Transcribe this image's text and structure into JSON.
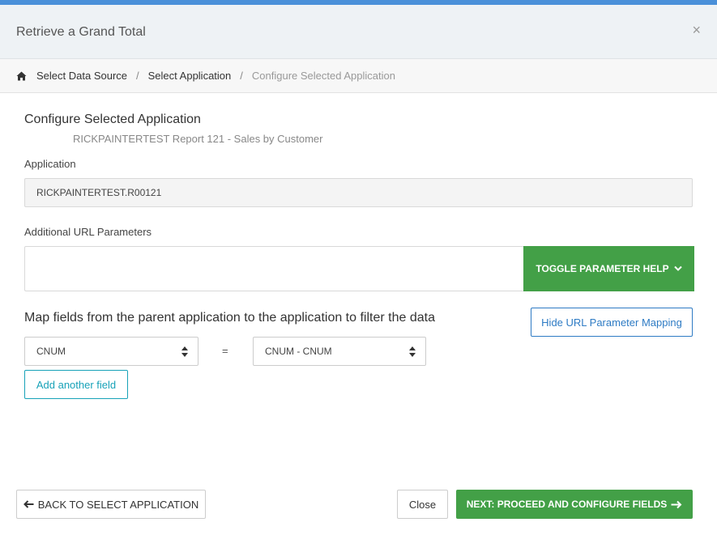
{
  "dialog": {
    "title": "Retrieve a Grand Total",
    "close_glyph": "×"
  },
  "breadcrumb": {
    "home_icon": "home-icon",
    "items": [
      "Select Data Source",
      "Select Application",
      "Configure Selected Application"
    ],
    "separator": "/"
  },
  "section": {
    "title": "Configure Selected Application",
    "subtitle": "RICKPAINTERTEST Report 121 - Sales by Customer"
  },
  "application": {
    "label": "Application",
    "value": "RICKPAINTERTEST.R00121"
  },
  "url_params": {
    "label": "Additional URL Parameters",
    "value": "",
    "toggle_label": "TOGGLE PARAMETER HELP",
    "toggle_icon": "chevron-down-icon"
  },
  "mapping": {
    "text": "Map fields from the parent application to the application to filter the data",
    "hide_label": "Hide URL Parameter Mapping",
    "parent_field": "CNUM",
    "equals": "=",
    "child_field": "CNUM - CNUM",
    "add_label": "Add another field"
  },
  "footer": {
    "back_label": "BACK TO SELECT APPLICATION",
    "close_label": "Close",
    "next_label": "NEXT: PROCEED AND CONFIGURE FIELDS"
  },
  "colors": {
    "accent_green": "#43a047",
    "accent_blue": "#2e7bc4",
    "accent_teal": "#17a2b8",
    "top_bar": "#4a90d9"
  }
}
